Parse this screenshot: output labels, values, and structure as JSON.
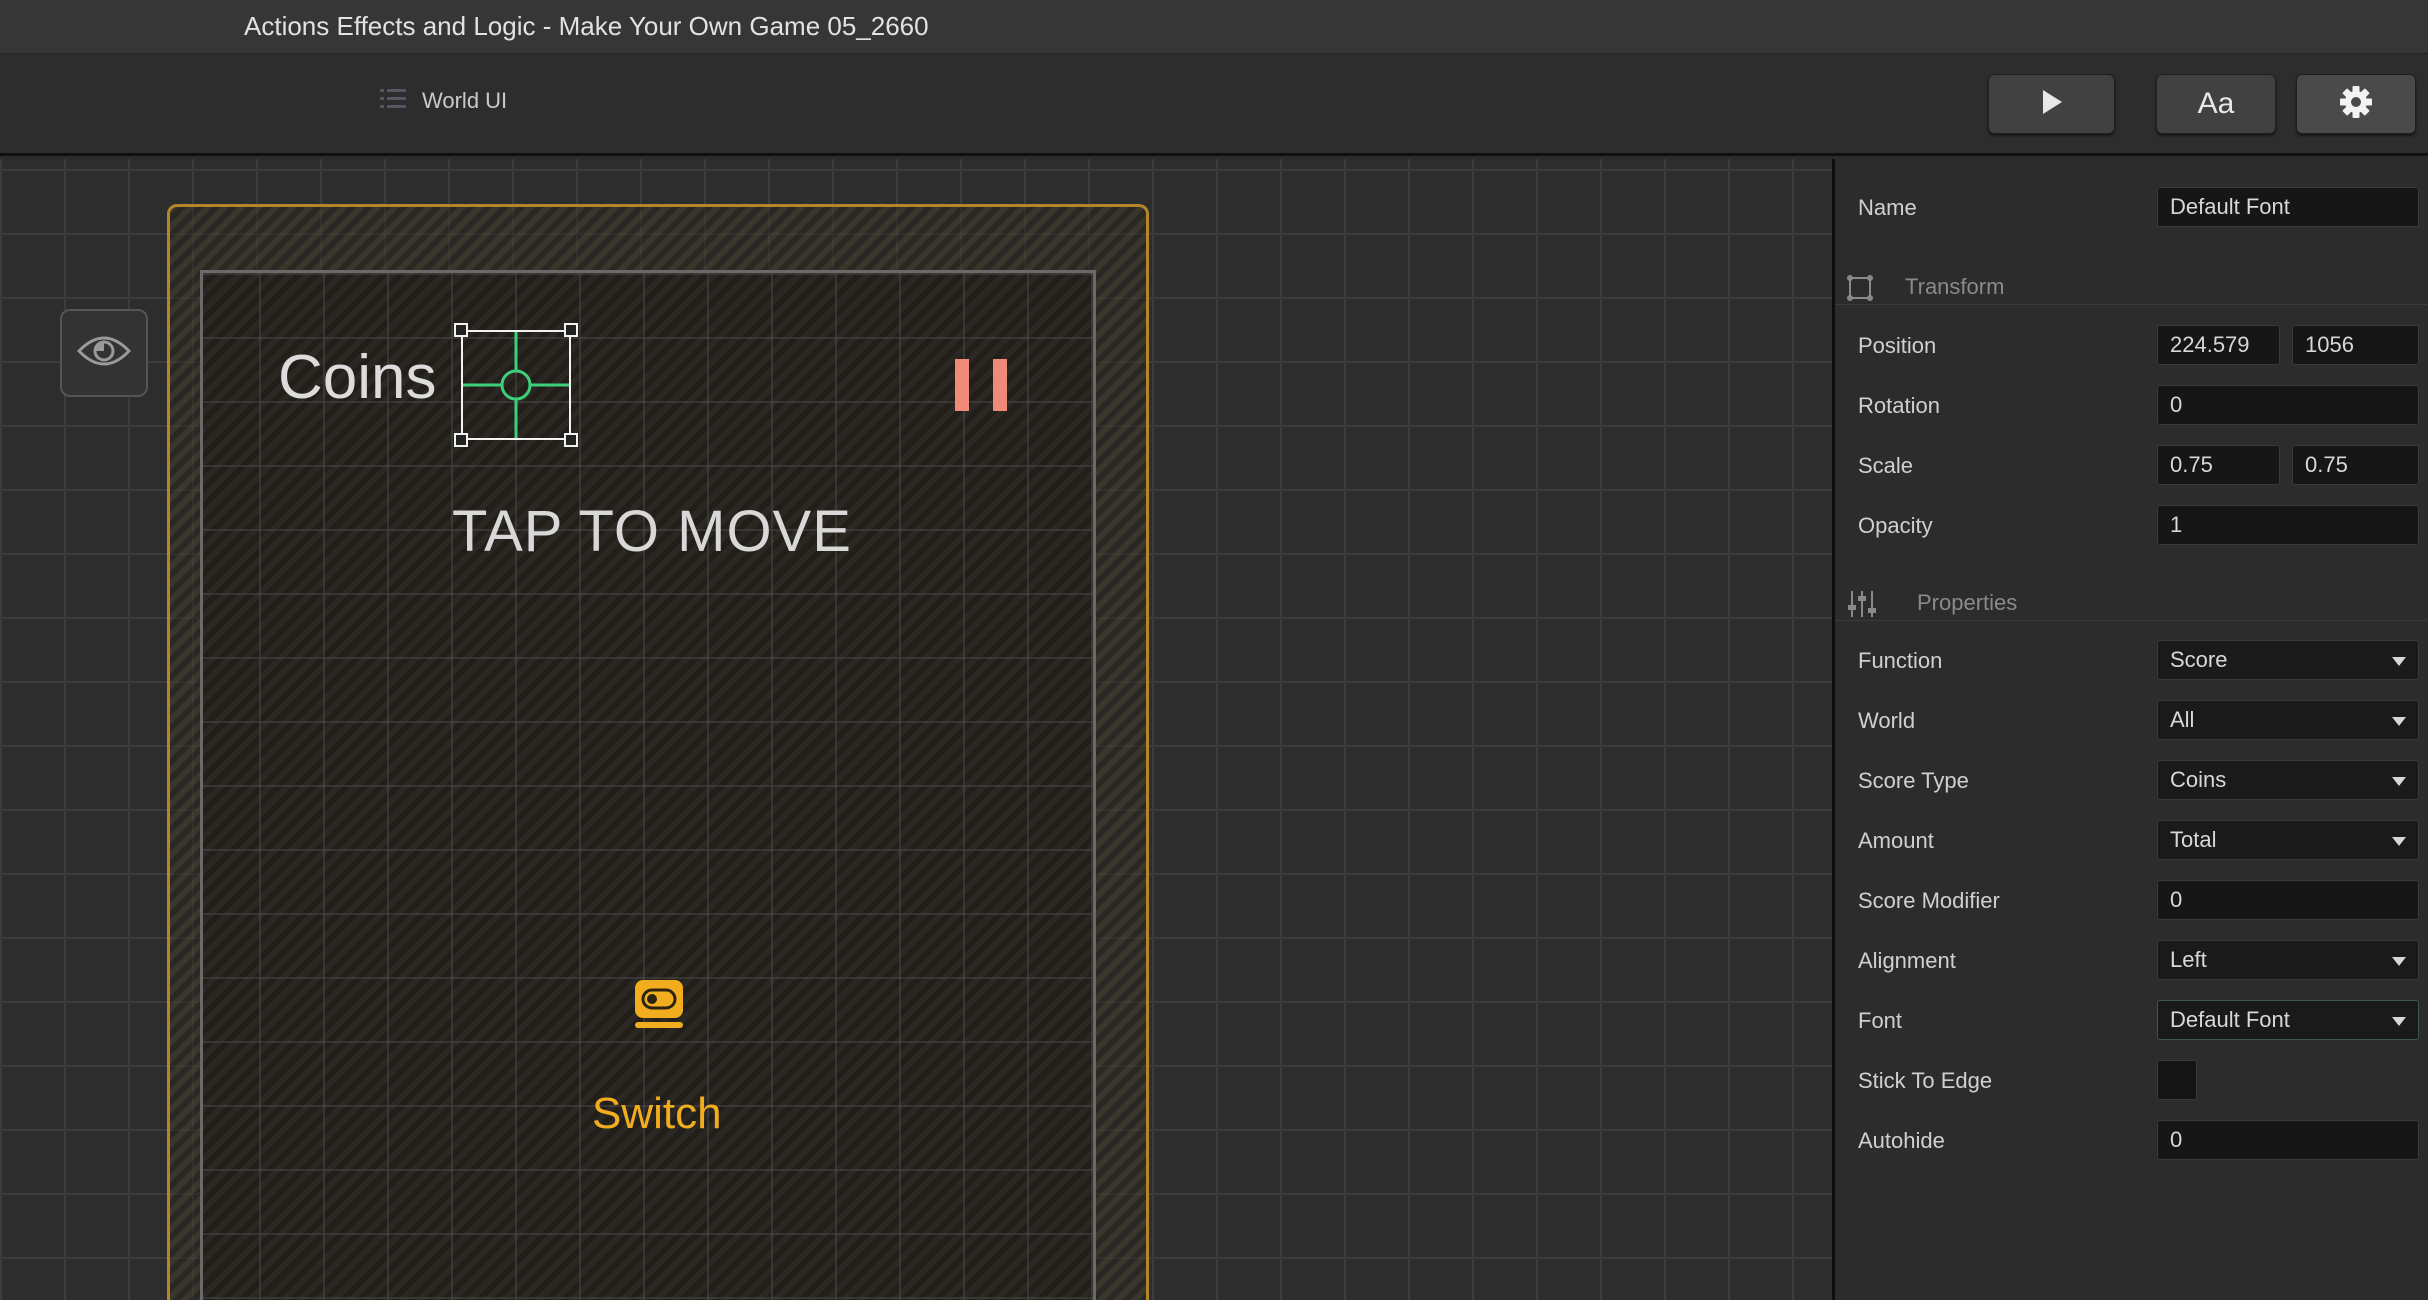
{
  "window": {
    "title": "Actions Effects and Logic - Make Your Own Game 05_2660"
  },
  "toolbar": {
    "breadcrumb": "World UI",
    "font_button_label": "Aa",
    "icons": {
      "breadcrumb": "list-icon",
      "play": "play-icon",
      "settings": "gear-icon"
    }
  },
  "canvas": {
    "coins_text": "Coins",
    "tap_text": "TAP TO MOVE",
    "switch_text": "Switch",
    "icons": {
      "visibility": "eye-icon",
      "pause": "pause-icon",
      "switch": "switch-icon",
      "anchor": "crosshair-icon"
    },
    "colors": {
      "frame_border": "#b48628",
      "switch_label": "#f2ad1f",
      "pause": "#f08a78",
      "anchor": "#3ecf7a"
    }
  },
  "panel": {
    "name": {
      "label": "Name",
      "value": "Default Font"
    },
    "transform": {
      "title": "Transform",
      "position": {
        "label": "Position",
        "x": "224.579",
        "y": "1056"
      },
      "rotation": {
        "label": "Rotation",
        "value": "0"
      },
      "scale": {
        "label": "Scale",
        "x": "0.75",
        "y": "0.75"
      },
      "opacity": {
        "label": "Opacity",
        "value": "1"
      }
    },
    "properties": {
      "title": "Properties",
      "function": {
        "label": "Function",
        "value": "Score"
      },
      "world": {
        "label": "World",
        "value": "All"
      },
      "score_type": {
        "label": "Score Type",
        "value": "Coins"
      },
      "amount": {
        "label": "Amount",
        "value": "Total"
      },
      "score_modifier": {
        "label": "Score Modifier",
        "value": "0"
      },
      "alignment": {
        "label": "Alignment",
        "value": "Left"
      },
      "font": {
        "label": "Font",
        "value": "Default Font"
      },
      "stick_to_edge": {
        "label": "Stick To Edge",
        "checked": false
      },
      "autohide": {
        "label": "Autohide",
        "value": "0"
      }
    }
  }
}
